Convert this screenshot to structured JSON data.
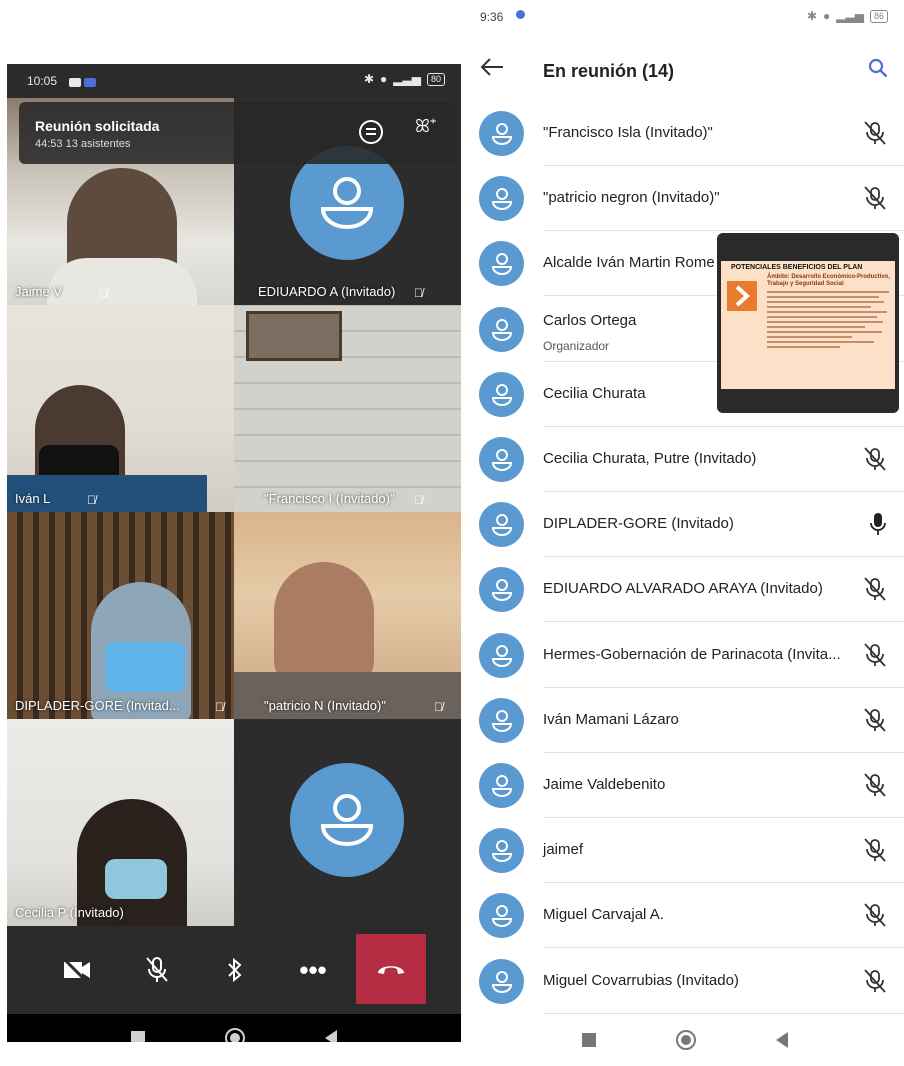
{
  "left_phone": {
    "status_bar": {
      "time": "10:05",
      "battery": "80"
    },
    "meeting": {
      "title": "Reunión solicitada",
      "subtitle": "44:53  13 asistentes"
    },
    "tiles": [
      {
        "name": "Jaime V"
      },
      {
        "name": "EDIUARDO A (Invitado)"
      },
      {
        "name": "Iván L"
      },
      {
        "name": "\"Francisco I (Invitado)\""
      },
      {
        "name": "DIPLADER-GORE (Invitad..."
      },
      {
        "name": "\"patricio N (Invitado)\""
      },
      {
        "name": "Cecilia P (Invitado)"
      }
    ],
    "call_controls": [
      "camera-off-icon",
      "mic-off-icon",
      "bluetooth-icon",
      "more-icon",
      "hang-up-icon"
    ]
  },
  "right_phone": {
    "status_bar": {
      "time": "9:36",
      "battery": "86"
    },
    "title": "En reunión (14)",
    "participants": [
      {
        "name": "\"Francisco Isla (Invitado)\"",
        "mic": "muted"
      },
      {
        "name": "\"patricio negron (Invitado)\"",
        "mic": "muted"
      },
      {
        "name": "Alcalde Iván Martin Rome",
        "mic": "hidden"
      },
      {
        "name": "Carlos Ortega",
        "role": "Organizador",
        "mic": "hidden"
      },
      {
        "name": "Cecilia Churata",
        "mic": "hidden"
      },
      {
        "name": "Cecilia Churata, Putre (Invitado)",
        "mic": "muted"
      },
      {
        "name": "DIPLADER-GORE (Invitado)",
        "mic": "on"
      },
      {
        "name": "EDIUARDO ALVARADO ARAYA (Invitado)",
        "mic": "muted"
      },
      {
        "name": "Hermes-Gobernación de Parinacota (Invita...",
        "mic": "muted"
      },
      {
        "name": "Iván Mamani Lázaro",
        "mic": "muted"
      },
      {
        "name": "Jaime Valdebenito",
        "mic": "muted"
      },
      {
        "name": "jaimef",
        "mic": "muted"
      },
      {
        "name": "Miguel Carvajal A.",
        "mic": "muted"
      },
      {
        "name": "Miguel Covarrubias (Invitado)",
        "mic": "muted"
      }
    ],
    "shared_slide": {
      "title": "POTENCIALES BENEFICIOS DEL PLAN",
      "subtitle": "Ámbito: Desarrollo Económico-Productivo, Trabajo y Seguridad Social"
    }
  },
  "colors": {
    "avatar": "#5b9ad0",
    "hangup": "#b52d43",
    "accent": "#4a6fd6"
  }
}
